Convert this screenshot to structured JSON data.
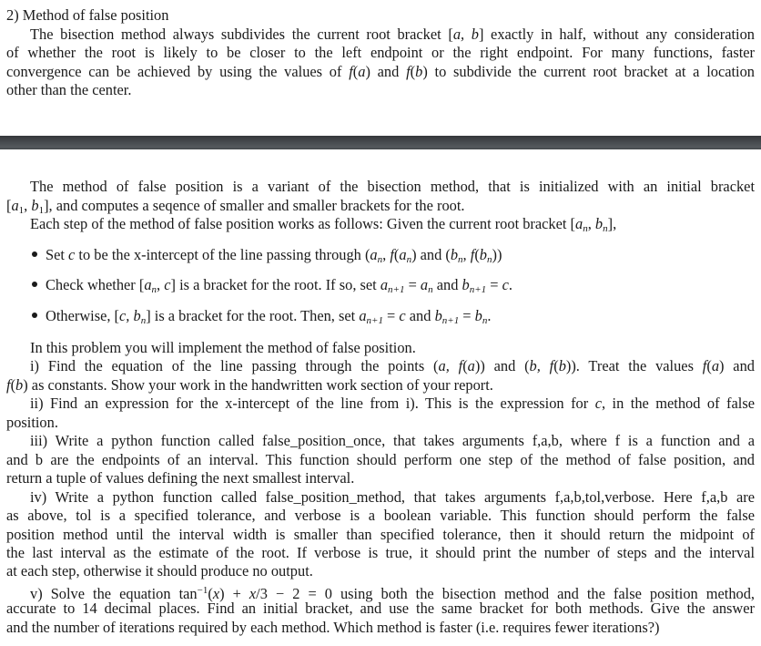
{
  "document": {
    "section_heading": "2)  Method of false position",
    "intro_lines": [
      [
        {
          "t": "The bisection method always subdivides the current root bracket ["
        },
        {
          "m": "a, b"
        },
        {
          "t": "] exactly in half, without any consideration"
        }
      ],
      [
        {
          "t": "of whether the root is likely to be closer to the left endpoint or the right endpoint.  For many functions, faster"
        }
      ],
      [
        {
          "t": "convergence can be achieved by using the values of "
        },
        {
          "m": "f"
        },
        {
          "t": "("
        },
        {
          "m": "a"
        },
        {
          "t": ") and "
        },
        {
          "m": "f"
        },
        {
          "t": "("
        },
        {
          "m": "b"
        },
        {
          "t": ") to subdivide the current root bracket at a location"
        }
      ],
      [
        {
          "t": "other than the center."
        }
      ]
    ],
    "method_lines": [
      [
        {
          "t": "The method of false position is a variant of the bisection method, that is initialized with an initial bracket"
        }
      ],
      [
        {
          "t": "["
        },
        {
          "m": "a"
        },
        {
          "s": "1"
        },
        {
          "t": ", "
        },
        {
          "m": "b"
        },
        {
          "s": "1"
        },
        {
          "t": "], and computes a seqence of smaller and smaller brackets for the root."
        }
      ],
      [
        {
          "t": "Each step of the method of false position works as follows: Given the current root bracket ["
        },
        {
          "m": "a"
        },
        {
          "sm": "n"
        },
        {
          "t": ", "
        },
        {
          "m": "b"
        },
        {
          "sm": "n"
        },
        {
          "t": "],"
        }
      ]
    ],
    "bullets": [
      [
        {
          "t": "Set "
        },
        {
          "m": "c"
        },
        {
          "t": " to be the x-intercept of the line passing through ("
        },
        {
          "m": "a"
        },
        {
          "sm": "n"
        },
        {
          "t": ", "
        },
        {
          "m": "f"
        },
        {
          "t": "("
        },
        {
          "m": "a"
        },
        {
          "sm": "n"
        },
        {
          "t": ") and ("
        },
        {
          "m": "b"
        },
        {
          "sm": "n"
        },
        {
          "t": ", "
        },
        {
          "m": "f"
        },
        {
          "t": "("
        },
        {
          "m": "b"
        },
        {
          "sm": "n"
        },
        {
          "t": "))"
        }
      ],
      [
        {
          "t": "Check whether ["
        },
        {
          "m": "a"
        },
        {
          "sm": "n"
        },
        {
          "t": ", "
        },
        {
          "m": "c"
        },
        {
          "t": "] is a bracket for the root.  If so, set "
        },
        {
          "m": "a"
        },
        {
          "sm": "n+1"
        },
        {
          "t": " = "
        },
        {
          "m": "a"
        },
        {
          "sm": "n"
        },
        {
          "t": " and "
        },
        {
          "m": "b"
        },
        {
          "sm": "n+1"
        },
        {
          "t": " = "
        },
        {
          "m": "c"
        },
        {
          "t": "."
        }
      ],
      [
        {
          "t": "Otherwise, ["
        },
        {
          "m": "c, b"
        },
        {
          "sm": "n"
        },
        {
          "t": "] is a bracket for the root.  Then, set "
        },
        {
          "m": "a"
        },
        {
          "sm": "n+1"
        },
        {
          "t": " = "
        },
        {
          "m": "c"
        },
        {
          "t": " and "
        },
        {
          "m": "b"
        },
        {
          "sm": "n+1"
        },
        {
          "t": " = "
        },
        {
          "m": "b"
        },
        {
          "sm": "n"
        },
        {
          "t": "."
        }
      ]
    ],
    "problem_lines": [
      {
        "indent": true,
        "last": true,
        "segs": [
          {
            "t": "In this problem you will implement the method of false position."
          }
        ]
      },
      {
        "indent": true,
        "segs": [
          {
            "t": "i) Find the equation of the line passing through the points ("
          },
          {
            "m": "a, f"
          },
          {
            "t": "("
          },
          {
            "m": "a"
          },
          {
            "t": ")) and ("
          },
          {
            "m": "b, f"
          },
          {
            "t": "("
          },
          {
            "m": "b"
          },
          {
            "t": ")).  Treat the values "
          },
          {
            "m": "f"
          },
          {
            "t": "("
          },
          {
            "m": "a"
          },
          {
            "t": ") and"
          }
        ]
      },
      {
        "indent": false,
        "last": true,
        "segs": [
          {
            "m": "f"
          },
          {
            "t": "("
          },
          {
            "m": "b"
          },
          {
            "t": ") as constants. Show your work in the handwritten work section of your report."
          }
        ]
      },
      {
        "indent": true,
        "segs": [
          {
            "t": "ii) Find an expression for the x-intercept of the line from i). This is the expression for "
          },
          {
            "m": "c"
          },
          {
            "t": ", in the method of false"
          }
        ]
      },
      {
        "indent": false,
        "last": true,
        "segs": [
          {
            "t": "position."
          }
        ]
      },
      {
        "indent": true,
        "segs": [
          {
            "t": "iii) Write a python function called false_position_once, that takes arguments f,a,b, where f is a function and a"
          }
        ]
      },
      {
        "indent": false,
        "segs": [
          {
            "t": "and b are the endpoints of an interval. This function should perform one step of the method of false position, and"
          }
        ]
      },
      {
        "indent": false,
        "last": true,
        "segs": [
          {
            "t": "return a tuple of values defining the next smallest interval."
          }
        ]
      },
      {
        "indent": true,
        "segs": [
          {
            "t": "iv) Write a python function called false_position_method, that takes arguments f,a,b,tol,verbose. Here f,a,b are"
          }
        ]
      },
      {
        "indent": false,
        "segs": [
          {
            "t": "as above, tol is a specified tolerance, and verbose is a boolean variable.  This function should perform the false"
          }
        ]
      },
      {
        "indent": false,
        "segs": [
          {
            "t": "position method until the interval width is smaller than specified tolerance, then it should return the midpoint of"
          }
        ]
      },
      {
        "indent": false,
        "segs": [
          {
            "t": "the last interval as the estimate of the root. If verbose is true, it should print the number of steps and the interval"
          }
        ]
      },
      {
        "indent": false,
        "last": true,
        "segs": [
          {
            "t": "at each step, otherwise it should produce no output."
          }
        ]
      },
      {
        "indent": true,
        "segs": [
          {
            "t": "v) Solve the equation tan"
          },
          {
            "sup": "−1"
          },
          {
            "t": "("
          },
          {
            "m": "x"
          },
          {
            "t": ") + "
          },
          {
            "m": "x"
          },
          {
            "t": "/3 − 2 = 0 using both the bisection method and the false position method,"
          }
        ]
      },
      {
        "indent": false,
        "segs": [
          {
            "t": "accurate to 14 decimal places.  Find an initial bracket, and use the same bracket for both methods.  Give the answer"
          }
        ]
      },
      {
        "indent": false,
        "last": true,
        "segs": [
          {
            "t": "and the number of iterations required by each method.  Which method is faster (i.e.  requires fewer iterations?)"
          }
        ]
      }
    ]
  }
}
